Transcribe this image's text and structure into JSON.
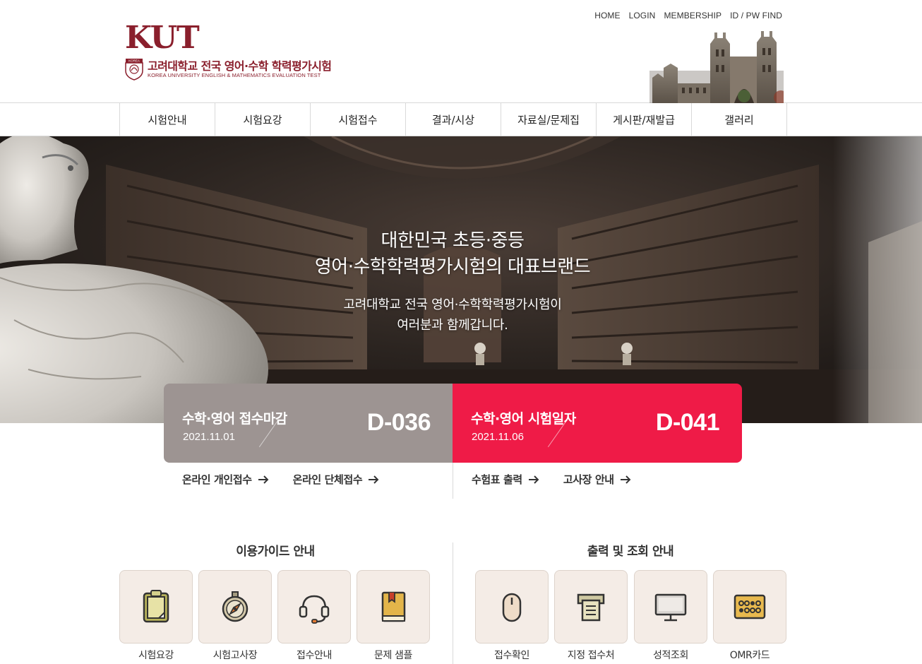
{
  "header": {
    "util_links": [
      "HOME",
      "LOGIN",
      "MEMBERSHIP",
      "ID / PW FIND"
    ],
    "logo": {
      "mark": "KUT",
      "name_ko": "고려대학교 전국 영어·수학 학력평가시험",
      "name_en": "KOREA UNIVERSITY ENGLISH & MATHEMATICS EVALUATION TEST",
      "emblem_text": "KOREA",
      "brand_color": "#8a1f2c"
    }
  },
  "gnb": [
    "시험안내",
    "시험요강",
    "시험접수",
    "결과/시상",
    "자료실/문제집",
    "게시판/재발급",
    "갤러리"
  ],
  "hero": {
    "title_line1": "대한민국 초등·중등",
    "title_line2": "영어·수학학력평가시험의 대표브랜드",
    "desc_line1": "고려대학교 전국 영어·수학학력평가시험이",
    "desc_line2": "여러분과 함께갑니다."
  },
  "dday": [
    {
      "label": "수학·영어 접수마감",
      "date": "2021.11.01",
      "count": "D-036",
      "color": "#9d9492"
    },
    {
      "label": "수학·영어 시험일자",
      "date": "2021.11.06",
      "count": "D-041",
      "color": "#ef1b47"
    }
  ],
  "quick_links": {
    "left": [
      "온라인 개인접수",
      "온라인 단체접수"
    ],
    "right": [
      "수험표 출력",
      "고사장 안내"
    ]
  },
  "guide_left": {
    "title": "이용가이드 안내",
    "items": [
      {
        "label": "시험요강",
        "icon": "clipboard-icon"
      },
      {
        "label": "시험고사장",
        "icon": "compass-icon"
      },
      {
        "label": "접수안내",
        "icon": "headset-icon"
      },
      {
        "label": "문제 샘플",
        "icon": "book-icon"
      }
    ]
  },
  "guide_right": {
    "title": "출력 및 조회 안내",
    "items": [
      {
        "label": "접수확인",
        "icon": "mouse-icon"
      },
      {
        "label": "지정 접수처",
        "icon": "printer-icon"
      },
      {
        "label": "성적조회",
        "icon": "monitor-icon"
      },
      {
        "label": "OMR카드",
        "icon": "omr-card-icon"
      }
    ]
  }
}
